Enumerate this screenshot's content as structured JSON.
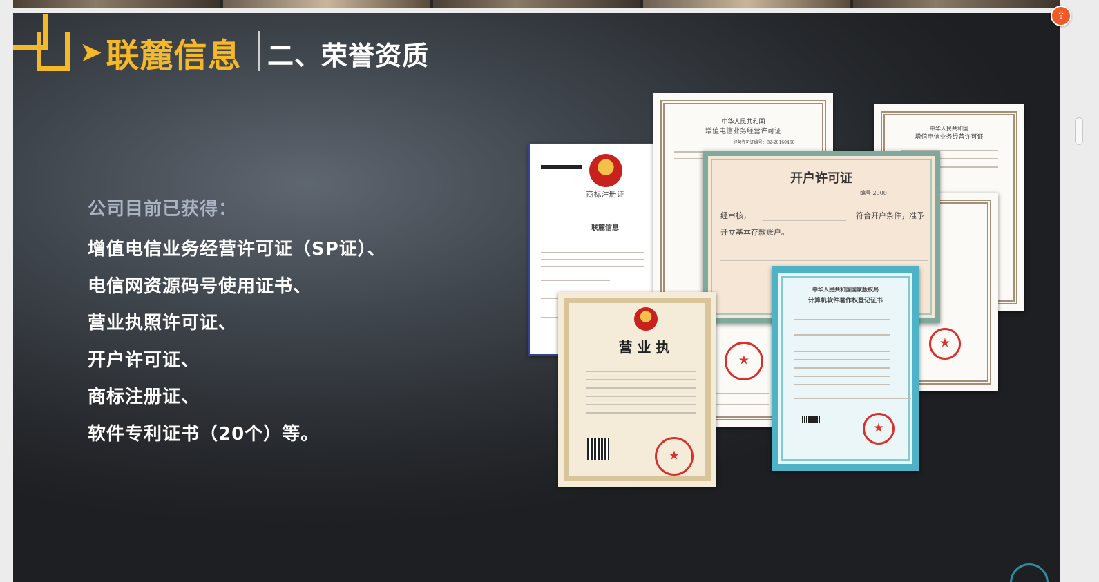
{
  "header": {
    "brand_arrow": "➤",
    "brand_name": "联麓信息",
    "section_title": "二、荣誉资质"
  },
  "content": {
    "intro": "公司目前已获得：",
    "items": [
      "增值电信业务经营许可证（SP证）、",
      "电信网资源码号使用证书、",
      "营业执照许可证、",
      "开户许可证、",
      "商标注册证、",
      "软件专利证书（20个）等。"
    ]
  },
  "certificates": {
    "trademark_title": "商标注册证",
    "trademark_brand": "联麓信息",
    "telecom_title_1": "中华人民共和国",
    "telecom_title_2": "增值电信业务经营许可证",
    "telecom_number": "经营许可证编号：B2-20160460",
    "open_account_title": "开户许可证",
    "open_account_line1": "经审核，",
    "open_account_line1b": "符合开户条件，准予",
    "open_account_line2": "开立基本存款账户。",
    "open_account_number": "编号 2900-",
    "business_title": "营 业 执",
    "software_title_1": "中华人民共和国国家版权局",
    "software_title_2": "计算机软件著作权登记证书"
  },
  "colors": {
    "accent": "#f4b829",
    "intro_text": "#a9b3c2",
    "body_text": "#ffffff",
    "seal_red": "#d8312c",
    "share_button": "#f05a28"
  },
  "icons": {
    "share": "share-icon",
    "logo": "logo-mark-icon"
  }
}
